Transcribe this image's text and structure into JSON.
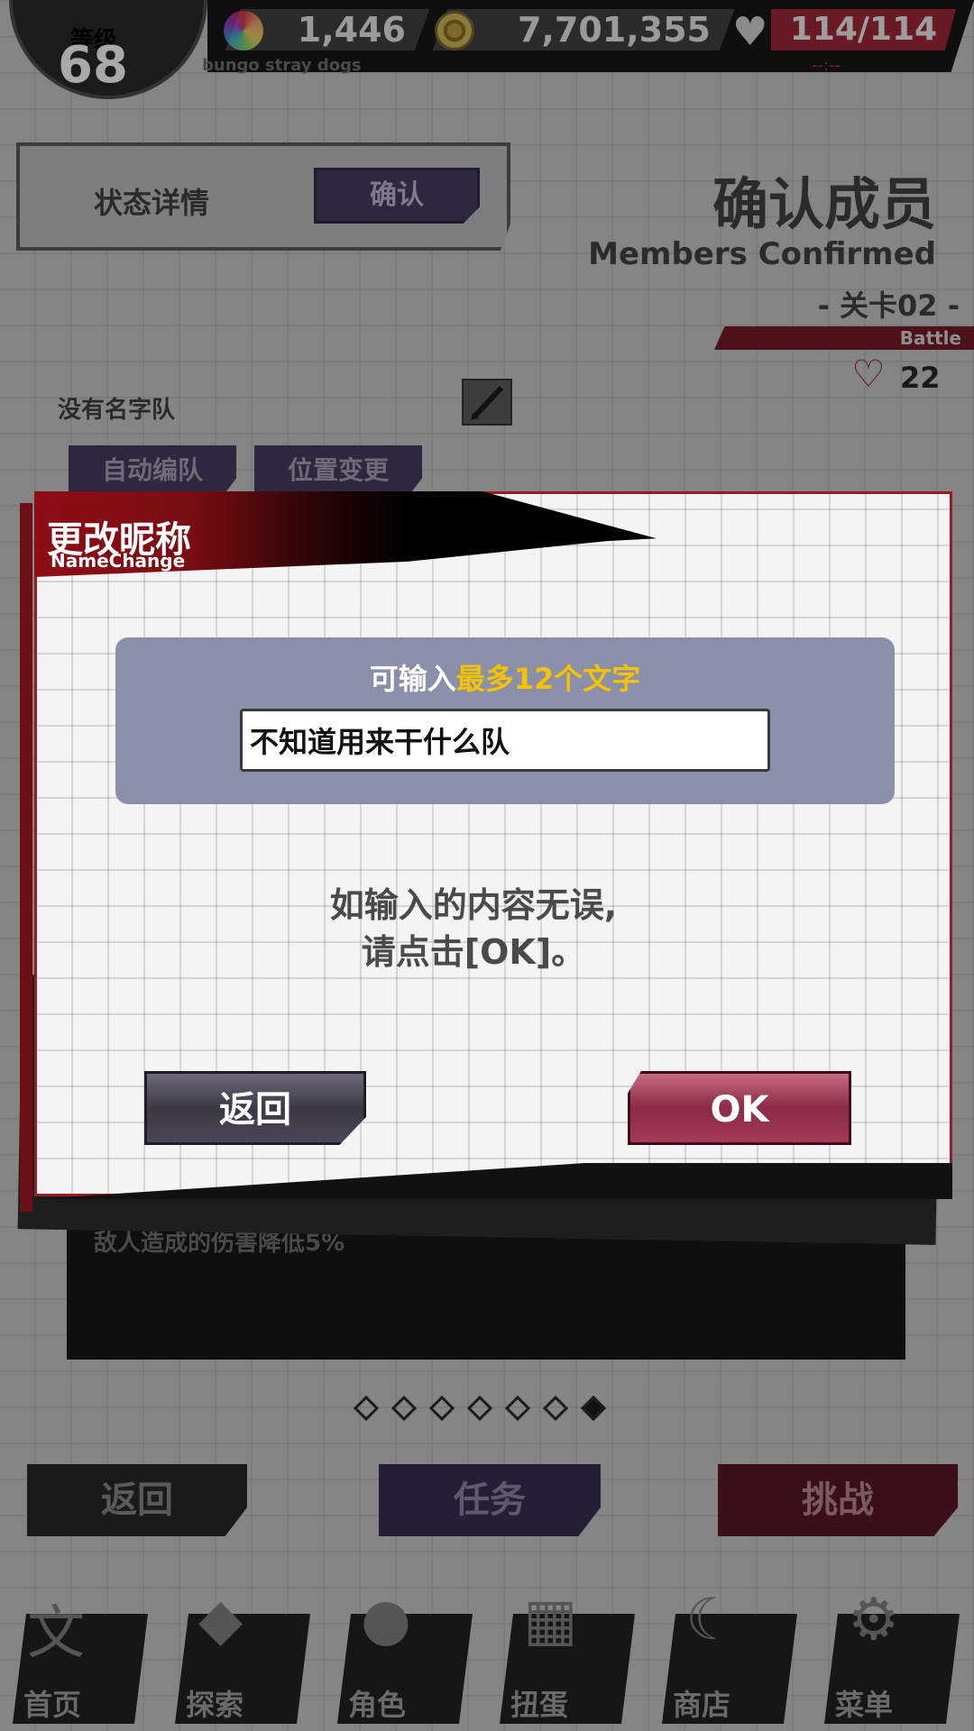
{
  "header": {
    "level_label": "等级",
    "level_value": "68",
    "gems": "1,446",
    "coins": "7,701,355",
    "ap": "114/114",
    "game_subtitle": "bungo stray dogs",
    "ap_timer": "--:--"
  },
  "status": {
    "label": "状态详情",
    "confirm_button": "确认"
  },
  "page": {
    "title_zh": "确认成员",
    "title_en": "Members Confirmed",
    "stage": "- 关卡02 -",
    "battle_tag": "Battle",
    "ap_cost": "22"
  },
  "team": {
    "name": "没有名字队",
    "auto_button": "自动编队",
    "position_button": "位置变更"
  },
  "modal": {
    "title_zh": "更改昵称",
    "title_en": "NameChange",
    "hint_prefix": "可输入",
    "hint_accent": "最多12个文字",
    "input_value": "不知道用来干什么队",
    "message_line1": "如输入的内容无误,",
    "message_line2": "请点击[OK]。",
    "back_button": "返回",
    "ok_button": "OK"
  },
  "skill": {
    "text": "敌人造成的伤害降低5%"
  },
  "pagination": {
    "total": 7,
    "active_index": 6
  },
  "actions": {
    "back": "返回",
    "task": "任务",
    "challenge": "挑战"
  },
  "nav": {
    "items": [
      {
        "label": "首页",
        "icon": "home-icon"
      },
      {
        "label": "探索",
        "icon": "explore-icon"
      },
      {
        "label": "角色",
        "icon": "characters-icon"
      },
      {
        "label": "扭蛋",
        "icon": "gacha-icon"
      },
      {
        "label": "商店",
        "icon": "shop-icon"
      },
      {
        "label": "菜单",
        "icon": "menu-gear-icon"
      }
    ]
  },
  "colors": {
    "accent_yellow": "#f5c200",
    "modal_red": "#9a1b26",
    "input_panel": "#8b90aa"
  }
}
